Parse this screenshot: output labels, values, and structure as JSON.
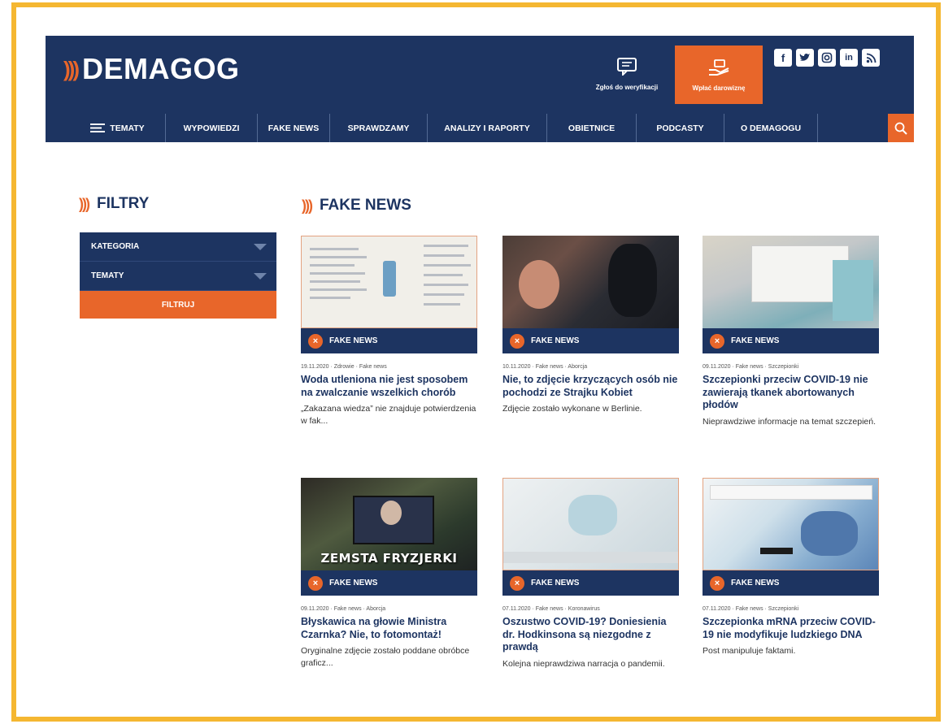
{
  "brand": {
    "waves": ")))",
    "name": "DEMAGOG"
  },
  "header": {
    "report_label": "Zgłoś do weryfikacji",
    "donate_label": "Wpłać darowiznę",
    "socials": [
      "f",
      "t",
      "ig",
      "in",
      "rss"
    ]
  },
  "nav": {
    "items": [
      "TEMATY",
      "WYPOWIEDZI",
      "FAKE NEWS",
      "SPRAWDZAMY",
      "ANALIZY I RAPORTY",
      "OBIETNICE",
      "PODCASTY",
      "O DEMAGOGU"
    ]
  },
  "sidebar": {
    "title": "FILTRY",
    "filters": [
      "KATEGORIA",
      "TEMATY"
    ],
    "button": "FILTRUJ"
  },
  "main": {
    "title": "FAKE NEWS",
    "cards": [
      {
        "badge": "FAKE NEWS",
        "meta": "19.11.2020 · Zdrowie · Fake news",
        "title": "Woda utleniona nie jest sposobem na zwalczanie wszelkich chorób",
        "lead": "„Zakazana wiedza” nie znajduje potwierdzenia w fak..."
      },
      {
        "badge": "FAKE NEWS",
        "meta": "10.11.2020 · Fake news · Aborcja",
        "title": "Nie, to zdjęcie krzyczących osób nie pochodzi ze Strajku Kobiet",
        "lead": "Zdjęcie zostało wykonane w Berlinie."
      },
      {
        "badge": "FAKE NEWS",
        "meta": "09.11.2020 · Fake news · Szczepionki",
        "title": "Szczepionki przeciw COVID-19 nie zawierają tkanek abortowanych płodów",
        "lead": "Nieprawdziwe informacje na temat szczepień."
      },
      {
        "badge": "FAKE NEWS",
        "meta": "09.11.2020 · Fake news · Aborcja",
        "overlay": "ZEMSTA FRYZJERKI",
        "title": "Błyskawica na głowie Ministra Czarnka? Nie, to fotomontaż!",
        "lead": "Oryginalne zdjęcie zostało poddane obróbce graficz..."
      },
      {
        "badge": "FAKE NEWS",
        "meta": "07.11.2020 · Fake news · Koronawirus",
        "title": "Oszustwo COVID-19? Doniesienia dr. Hodkinsona są niezgodne z prawdą",
        "lead": "Kolejna nieprawdziwa narracja o pandemii."
      },
      {
        "badge": "FAKE NEWS",
        "meta": "07.11.2020 · Fake news · Szczepionki",
        "title": "Szczepionka mRNA przeciw COVID-19 nie modyfikuje ludzkiego DNA",
        "lead": "Post manipuluje faktami."
      }
    ]
  },
  "colors": {
    "navy": "#1d3461",
    "orange": "#e8662a",
    "frame": "#f5b731"
  }
}
